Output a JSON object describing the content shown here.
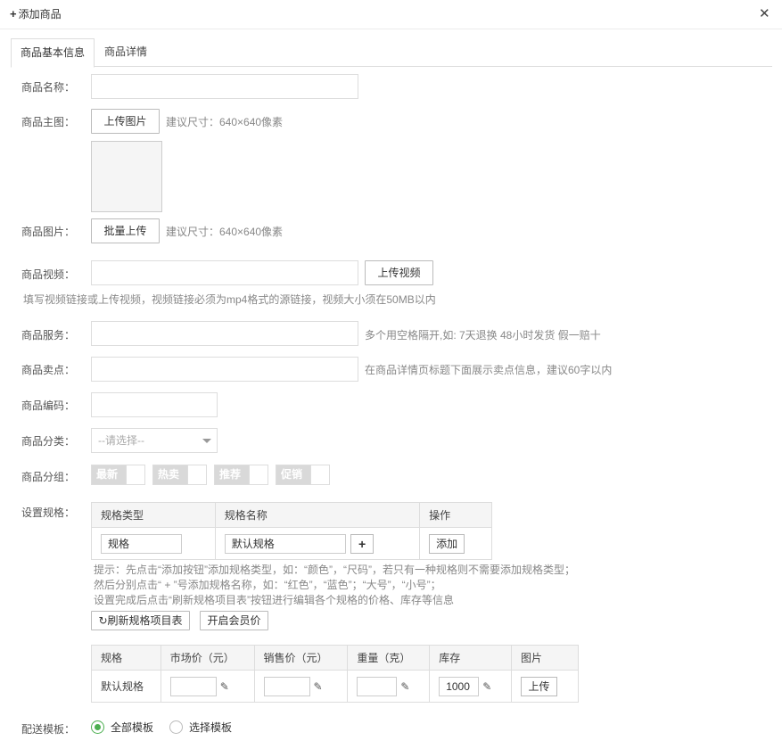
{
  "header": {
    "title": "添加商品",
    "plus_icon": "+",
    "close_icon": "✕"
  },
  "tabs": [
    {
      "label": "商品基本信息",
      "active": true
    },
    {
      "label": "商品详情",
      "active": false
    }
  ],
  "form": {
    "name": {
      "label": "商品名称：",
      "value": ""
    },
    "main_image": {
      "label": "商品主图：",
      "button": "上传图片",
      "hint": "建议尺寸：640×640像素"
    },
    "images": {
      "label": "商品图片：",
      "button": "批量上传",
      "hint": "建议尺寸：640×640像素"
    },
    "video": {
      "label": "商品视频：",
      "value": "",
      "button": "上传视频",
      "hint": "填写视频链接或上传视频，视频链接必须为mp4格式的源链接，视频大小须在50MB以内"
    },
    "service": {
      "label": "商品服务：",
      "value": "",
      "hint": "多个用空格隔开,如: 7天退换 48小时发货 假一赔十"
    },
    "selling_point": {
      "label": "商品卖点：",
      "value": "",
      "hint": "在商品详情页标题下面展示卖点信息，建议60字以内"
    },
    "code": {
      "label": "商品编码：",
      "value": ""
    },
    "category": {
      "label": "商品分类：",
      "placeholder": "--请选择--"
    },
    "group": {
      "label": "商品分组：",
      "toggles": [
        "最新",
        "热卖",
        "推荐",
        "促销"
      ]
    },
    "spec": {
      "label": "设置规格：",
      "headers": [
        "规格类型",
        "规格名称",
        "操作"
      ],
      "row": {
        "type": "规格",
        "name": "默认规格",
        "plus": "+",
        "add": "添加"
      },
      "notes": [
        "提示：先点击“添加按钮”添加规格类型，如：“颜色”，“尺码”，若只有一种规格则不需要添加规格类型；",
        "然后分别点击“ + ”号添加规格名称，如：“红色”，“蓝色”；“大号”，“小号”；",
        "设置完成后点击“刷新规格项目表”按钮进行编辑各个规格的价格、库存等信息"
      ],
      "refresh_button": "刷新规格项目表",
      "refresh_icon": "↻",
      "member_button": "开启会员价"
    },
    "sku": {
      "headers": [
        "规格",
        "市场价（元）",
        "销售价（元）",
        "重量（克）",
        "库存",
        "图片"
      ],
      "row": {
        "name": "默认规格",
        "market_price": "",
        "sale_price": "",
        "weight": "",
        "stock": "1000",
        "upload": "上传"
      },
      "edit_icon": "✎"
    },
    "shipping": {
      "label": "配送模板：",
      "options": [
        "全部模板",
        "选择模板"
      ],
      "selected": 0
    }
  }
}
